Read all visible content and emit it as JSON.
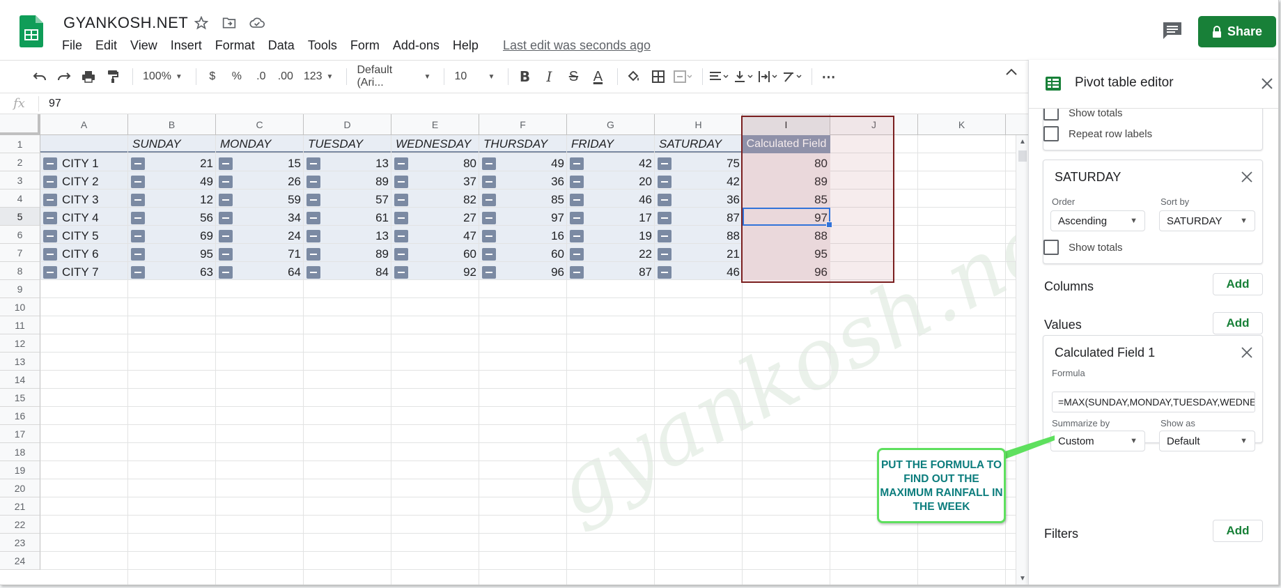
{
  "app": {
    "doc_title": "GYANKOSH.NET",
    "menu": [
      "File",
      "Edit",
      "View",
      "Insert",
      "Format",
      "Data",
      "Tools",
      "Form",
      "Add-ons",
      "Help"
    ],
    "last_edit": "Last edit was seconds ago",
    "share_label": "Share"
  },
  "toolbar": {
    "zoom": "100%",
    "currency": "$",
    "percent": "%",
    "dec_decrease": ".0",
    "dec_increase": ".00",
    "number_format": "123",
    "font": "Default (Ari...",
    "font_size": "10",
    "bold": "B",
    "italic": "I",
    "strike": "S",
    "text_color": "A",
    "more": "⋯"
  },
  "formula_bar": {
    "fx": "fx",
    "value": "97"
  },
  "grid": {
    "columns": [
      "A",
      "B",
      "C",
      "D",
      "E",
      "F",
      "G",
      "H",
      "I",
      "J",
      "K"
    ],
    "selected_column": "I",
    "rows": [
      "1",
      "2",
      "3",
      "4",
      "5",
      "6",
      "7",
      "8",
      "9",
      "10",
      "11",
      "12",
      "13",
      "14",
      "15",
      "16",
      "17",
      "18",
      "19",
      "20",
      "21",
      "22",
      "23",
      "24"
    ],
    "selected_row": "5",
    "pivot_headers": [
      "SUNDAY",
      "MONDAY",
      "TUESDAY",
      "WEDNESDAY",
      "THURSDAY",
      "FRIDAY",
      "SATURDAY"
    ],
    "calc_header": "Calculated Field",
    "cities": [
      {
        "name": "CITY 1",
        "values": [
          "21",
          "15",
          "13",
          "80",
          "49",
          "42",
          "75"
        ],
        "calc": "80"
      },
      {
        "name": "CITY 2",
        "values": [
          "49",
          "26",
          "89",
          "37",
          "36",
          "20",
          "42"
        ],
        "calc": "89"
      },
      {
        "name": "CITY 3",
        "values": [
          "12",
          "59",
          "57",
          "82",
          "85",
          "46",
          "36"
        ],
        "calc": "85"
      },
      {
        "name": "CITY 4",
        "values": [
          "56",
          "34",
          "61",
          "27",
          "97",
          "17",
          "87"
        ],
        "calc": "97"
      },
      {
        "name": "CITY 5",
        "values": [
          "69",
          "24",
          "13",
          "47",
          "16",
          "19",
          "88"
        ],
        "calc": "88"
      },
      {
        "name": "CITY 6",
        "values": [
          "95",
          "71",
          "89",
          "60",
          "60",
          "22",
          "21"
        ],
        "calc": "95"
      },
      {
        "name": "CITY 7",
        "values": [
          "63",
          "64",
          "84",
          "92",
          "96",
          "87",
          "46"
        ],
        "calc": "96"
      }
    ],
    "watermark": "gyankosh.net"
  },
  "panel": {
    "title": "Pivot table editor",
    "show_totals_top": "Show totals",
    "repeat_row_labels": "Repeat row labels",
    "saturday_card": {
      "title": "SATURDAY",
      "order_label": "Order",
      "order_value": "Ascending",
      "sort_label": "Sort by",
      "sort_value": "SATURDAY",
      "show_totals": "Show totals"
    },
    "columns_label": "Columns",
    "values_label": "Values",
    "add_label": "Add",
    "calc_card": {
      "title": "Calculated Field 1",
      "formula_label": "Formula",
      "formula_value": "=MAX(SUNDAY,MONDAY,TUESDAY,WEDNE",
      "summarize_label": "Summarize by",
      "summarize_value": "Custom",
      "show_as_label": "Show as",
      "show_as_value": "Default"
    },
    "filters_label": "Filters"
  },
  "callout": {
    "text": "PUT THE FORMULA TO FIND OUT THE MAXIMUM RAINFALL IN THE WEEK",
    "border_color": "#5ee05e",
    "text_color": "#0c7d7d"
  },
  "colors": {
    "accent_green": "#188038",
    "pivot_header": "#8795b0",
    "pivot_bg": "#e8edf4",
    "highlight_border": "#7a1f1f"
  }
}
